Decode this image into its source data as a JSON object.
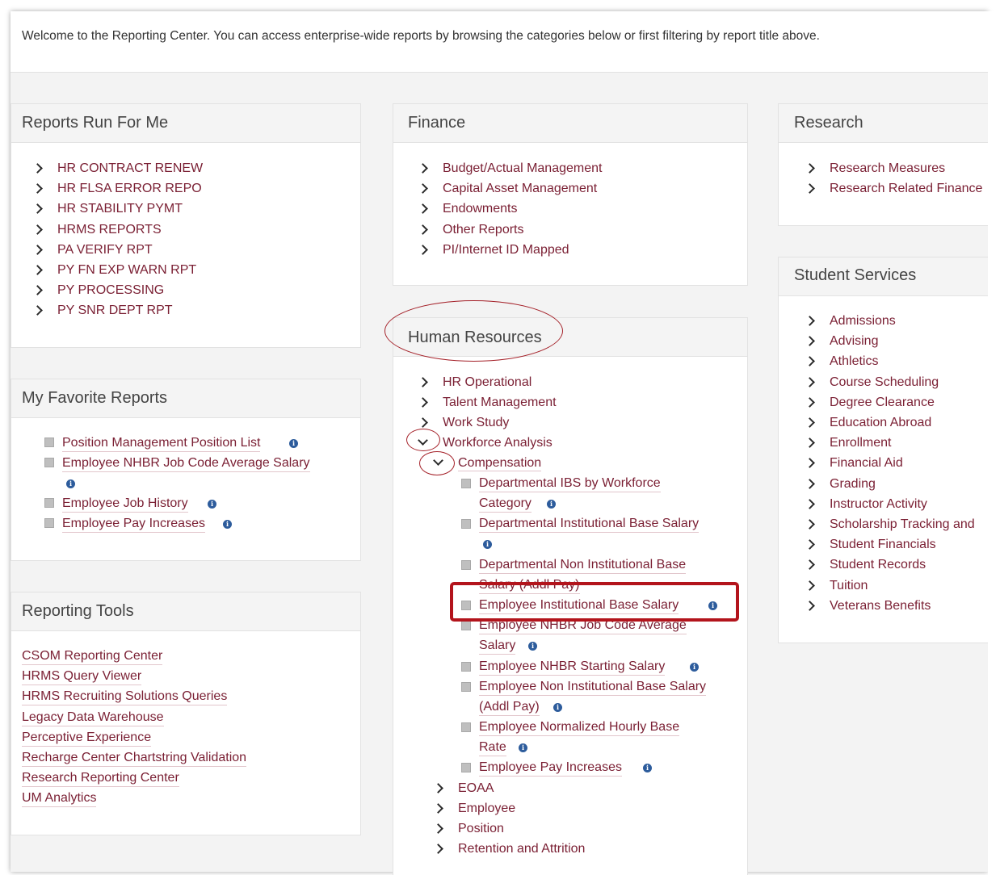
{
  "welcome": "Welcome to the Reporting Center. You can access enterprise-wide reports by browsing the categories below or first filtering by report title above.",
  "panels": {
    "reports_run_for_me": {
      "title": "Reports Run For Me",
      "items": [
        "HR CONTRACT RENEW",
        "HR FLSA ERROR REPO",
        "HR STABILITY PYMT",
        "HRMS REPORTS",
        "PA VERIFY RPT",
        "PY FN EXP WARN RPT",
        "PY PROCESSING",
        "PY SNR DEPT RPT"
      ]
    },
    "favorites": {
      "title": "My Favorite Reports",
      "items": [
        "Position Management Position List",
        "Employee NHBR Job Code Average Salary",
        "Employee Job History",
        "Employee Pay Increases"
      ]
    },
    "reporting_tools": {
      "title": "Reporting Tools",
      "items": [
        "CSOM Reporting Center",
        "HRMS Query Viewer",
        "HRMS Recruiting Solutions Queries",
        "Legacy Data Warehouse",
        "Perceptive Experience",
        "Recharge Center Chartstring Validation",
        "Research Reporting Center",
        "UM Analytics"
      ]
    },
    "finance": {
      "title": "Finance",
      "items": [
        "Budget/Actual Management",
        "Capital Asset Management",
        "Endowments",
        "Other Reports",
        "PI/Internet ID Mapped"
      ]
    },
    "hr": {
      "title": "Human Resources",
      "top_items": [
        "HR Operational",
        "Talent Management",
        "Work Study",
        "Workforce Analysis"
      ],
      "sub_folder": "Compensation",
      "comp_reports": [
        {
          "l1": "Departmental IBS by Workforce",
          "l2": "Category"
        },
        {
          "l1": "Departmental Institutional Base Salary",
          "l2": ""
        },
        {
          "l1": "Departmental Non Institutional Base",
          "l2": "Salary (Addl Pay)"
        },
        {
          "l1": "Employee Institutional Base Salary",
          "l2": ""
        },
        {
          "l1": "Employee NHBR Job Code Average",
          "l2": "Salary"
        },
        {
          "l1": "Employee NHBR Starting Salary",
          "l2": ""
        },
        {
          "l1": "Employee Non Institutional Base Salary",
          "l2": "(Addl Pay)"
        },
        {
          "l1": "Employee Normalized Hourly Base",
          "l2": "Rate"
        },
        {
          "l1": "Employee Pay Increases",
          "l2": ""
        }
      ],
      "bottom_items": [
        "EOAA",
        "Employee",
        "Position",
        "Retention and Attrition"
      ]
    },
    "research": {
      "title": "Research",
      "items": [
        "Research Measures",
        "Research Related Finance"
      ]
    },
    "student_services": {
      "title": "Student Services",
      "items": [
        "Admissions",
        "Advising",
        "Athletics",
        "Course Scheduling",
        "Degree Clearance",
        "Education Abroad",
        "Enrollment",
        "Financial Aid",
        "Grading",
        "Instructor Activity",
        "Scholarship Tracking and",
        "Student Financials",
        "Student Records",
        "Tuition",
        "Veterans Benefits"
      ]
    }
  },
  "icons": {
    "info": "i",
    "doc": "document-icon",
    "chevron": "chevron-right-icon"
  },
  "colors": {
    "link": "#7a1f33",
    "annotation": "#b3141c",
    "info": "#2d5c9c"
  }
}
